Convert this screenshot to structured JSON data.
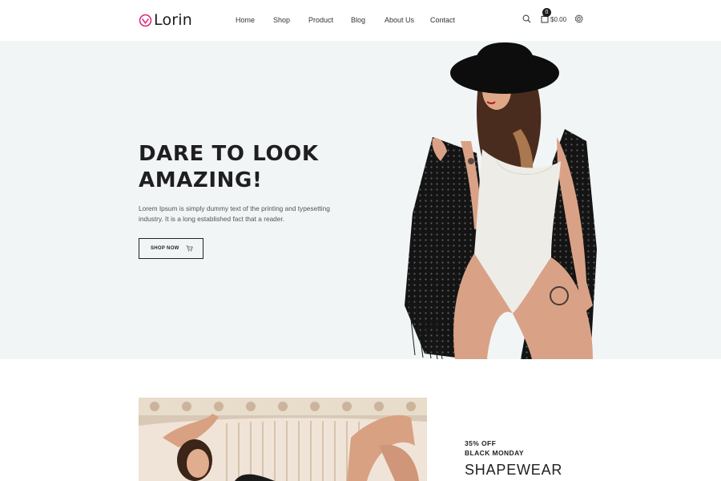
{
  "brand": {
    "name": "Lorin",
    "accent": "#e0247a"
  },
  "nav": {
    "items": [
      {
        "label": "Home"
      },
      {
        "label": "Shop"
      },
      {
        "label": "Product"
      },
      {
        "label": "Blog"
      },
      {
        "label": "About Us"
      },
      {
        "label": "Contact"
      }
    ]
  },
  "header_icons": {
    "search": "search-icon",
    "cart": "shopping-bag-icon",
    "settings": "gear-icon"
  },
  "cart": {
    "count": "0",
    "total": "$0.00"
  },
  "hero": {
    "title": "DARE TO LOOK\nAMAZING!",
    "description": "Lorem Ipsum is simply dummy text of the printing and typesetting industry. It is a long established fact that a reader.",
    "button_label": "SHOP NOW",
    "button_icon": "cart-icon",
    "background": "#f1f5f6"
  },
  "promo": {
    "discount": "35% OFF",
    "subtitle": "BLACK MONDAY",
    "title": "SHAPEWEAR"
  }
}
